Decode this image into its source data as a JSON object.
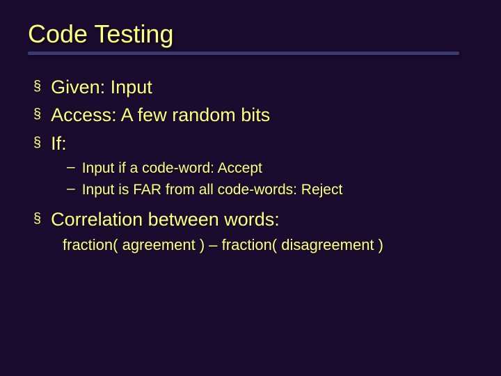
{
  "slide": {
    "title": "Code Testing",
    "bullets": [
      {
        "text": "Given: Input"
      },
      {
        "text": "Access: A few random bits"
      },
      {
        "text": "If:"
      }
    ],
    "sub_bullets": [
      {
        "text": "Input if a code-word: Accept"
      },
      {
        "text": "Input is FAR from all code-words: Reject"
      }
    ],
    "bullets2": [
      {
        "text": "Correlation between words:"
      }
    ],
    "indent_line": "fraction( agreement ) – fraction( disagreement )"
  }
}
